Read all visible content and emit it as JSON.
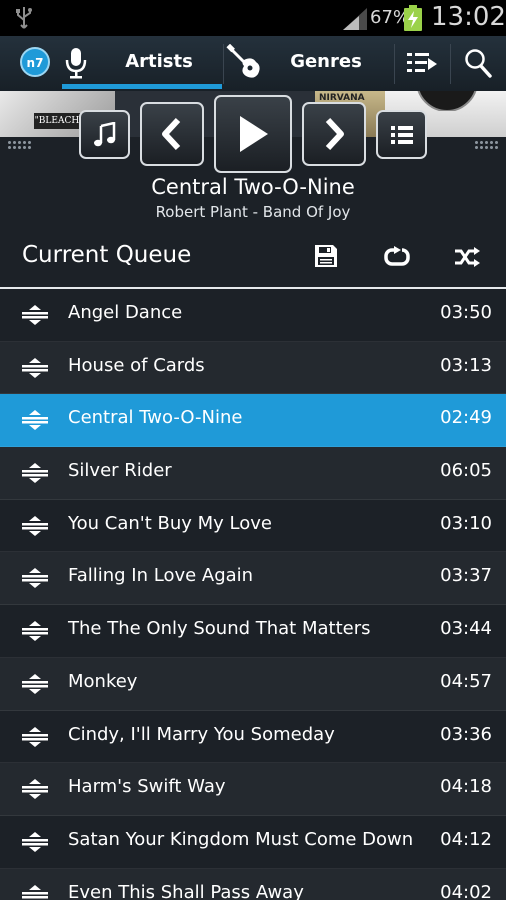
{
  "status_bar": {
    "battery_percent": "67%",
    "time": "13:02",
    "icons": [
      "usb-icon",
      "signal-icon",
      "battery-charging-icon"
    ]
  },
  "action_bar": {
    "tabs": [
      {
        "label": "Artists",
        "selected": true
      },
      {
        "label": "Genres",
        "selected": false
      }
    ],
    "accent_color": "#1f9ad8",
    "icons": [
      "app-logo-icon",
      "microphone-icon",
      "guitar-icon",
      "play-queue-icon",
      "search-icon"
    ]
  },
  "album_art": {
    "label_1": "\"BLEACH\"",
    "label_2": "NIRVANA"
  },
  "now_playing": {
    "title": "Central Two-O-Nine",
    "subtitle": "Robert Plant - Band Of Joy"
  },
  "queue": {
    "title": "Current Queue",
    "icons": [
      "save-icon",
      "repeat-icon",
      "shuffle-icon"
    ],
    "active_color": "#1f9ad8",
    "tracks": [
      {
        "title": "Angel Dance",
        "duration": "03:50"
      },
      {
        "title": "House of Cards",
        "duration": "03:13"
      },
      {
        "title": "Central Two-O-Nine",
        "duration": "02:49",
        "playing": true
      },
      {
        "title": "Silver Rider",
        "duration": "06:05"
      },
      {
        "title": "You Can't Buy My Love",
        "duration": "03:10"
      },
      {
        "title": "Falling In Love Again",
        "duration": "03:37"
      },
      {
        "title": "The The Only Sound That Matters",
        "duration": "03:44"
      },
      {
        "title": "Monkey",
        "duration": "04:57"
      },
      {
        "title": "Cindy, I'll Marry You Someday",
        "duration": "03:36"
      },
      {
        "title": "Harm's Swift Way",
        "duration": "04:18"
      },
      {
        "title": "Satan Your Kingdom Must Come Down",
        "duration": "04:12"
      },
      {
        "title": "Even This Shall Pass Away",
        "duration": "04:02"
      }
    ]
  }
}
